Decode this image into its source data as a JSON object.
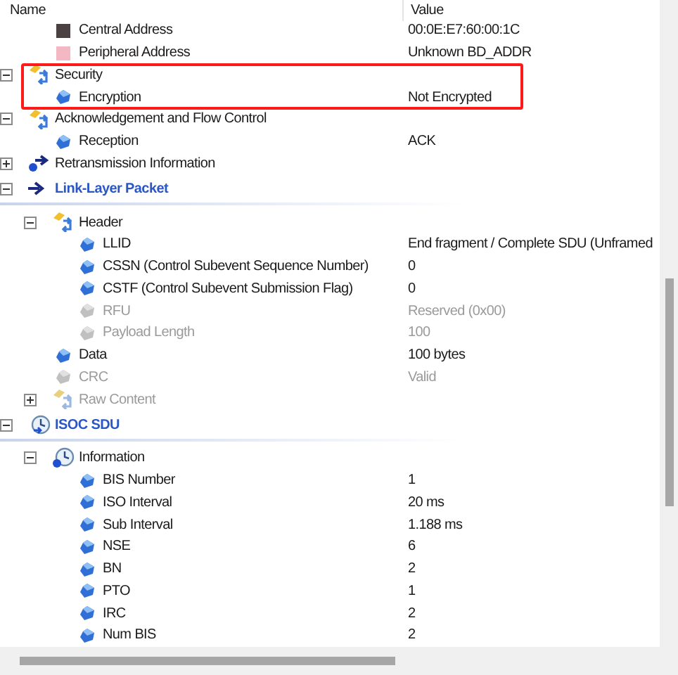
{
  "columns": [
    "Name",
    "Value"
  ],
  "tree": [
    {
      "children": [
        {
          "children": [
            {
              "label": "Central Address",
              "value": "00:0E:E7:60:00:1C",
              "kind": "swatch",
              "color": "#4a4242",
              "dimmed": false
            },
            {
              "label": "Peripheral Address",
              "value": "Unknown BD_ADDR",
              "kind": "swatch",
              "color": "#f4b8c4",
              "dimmed": false
            }
          ]
        },
        {
          "label": "Security",
          "kind": "group",
          "expanded": true,
          "dimmed": false,
          "highlighted": true,
          "children": [
            {
              "label": "Encryption",
              "value": "Not Encrypted",
              "kind": "leaf",
              "dimmed": false
            }
          ]
        },
        {
          "label": "Acknowledgement and Flow Control",
          "kind": "group",
          "expanded": true,
          "dimmed": false,
          "children": [
            {
              "label": "Reception",
              "value": "ACK",
              "kind": "leaf",
              "dimmed": false
            }
          ]
        }
      ]
    },
    {
      "label": "Retransmission Information",
      "kind": "link",
      "expanded": false,
      "dimmed": false
    },
    {
      "label": "Link-Layer Packet",
      "kind": "section",
      "expanded": true,
      "dimmed": false,
      "children": [
        {
          "label": "Header",
          "kind": "group",
          "expanded": true,
          "dimmed": false,
          "children": [
            {
              "label": "LLID",
              "value": "End fragment / Complete SDU (Unframed",
              "kind": "leaf",
              "dimmed": false
            },
            {
              "label": "CSSN (Control Subevent Sequence Number)",
              "value": "0",
              "kind": "leaf",
              "dimmed": false
            },
            {
              "label": "CSTF (Control Subevent Submission Flag)",
              "value": "0",
              "kind": "leaf",
              "dimmed": false
            },
            {
              "label": "RFU",
              "value": "Reserved (0x00)",
              "kind": "leaf",
              "dimmed": true
            },
            {
              "label": "Payload Length",
              "value": "100",
              "kind": "leaf",
              "dimmed": true
            }
          ]
        },
        {
          "label": "Data",
          "value": "100 bytes",
          "kind": "leaf",
          "dimmed": false
        },
        {
          "label": "CRC",
          "value": "Valid",
          "kind": "leaf",
          "dimmed": true
        },
        {
          "label": "Raw Content",
          "kind": "group",
          "expanded": false,
          "dimmed": true
        }
      ]
    },
    {
      "label": "ISOC SDU",
      "kind": "timing",
      "expanded": true,
      "dimmed": false,
      "children": [
        {
          "label": "Information",
          "kind": "timer",
          "expanded": true,
          "dimmed": false,
          "children": [
            {
              "label": "BIS Number",
              "value": "1",
              "kind": "leaf",
              "dimmed": false
            },
            {
              "label": "ISO Interval",
              "value": "20 ms",
              "kind": "leaf",
              "dimmed": false
            },
            {
              "label": "Sub Interval",
              "value": "1.188 ms",
              "kind": "leaf",
              "dimmed": false
            },
            {
              "label": "NSE",
              "value": "6",
              "kind": "leaf",
              "dimmed": false
            },
            {
              "label": "BN",
              "value": "2",
              "kind": "leaf",
              "dimmed": false
            },
            {
              "label": "PTO",
              "value": "1",
              "kind": "leaf",
              "dimmed": false
            },
            {
              "label": "IRC",
              "value": "2",
              "kind": "leaf",
              "dimmed": false
            },
            {
              "label": "Num BIS",
              "value": "2",
              "kind": "leaf",
              "dimmed": false
            }
          ]
        }
      ]
    }
  ]
}
